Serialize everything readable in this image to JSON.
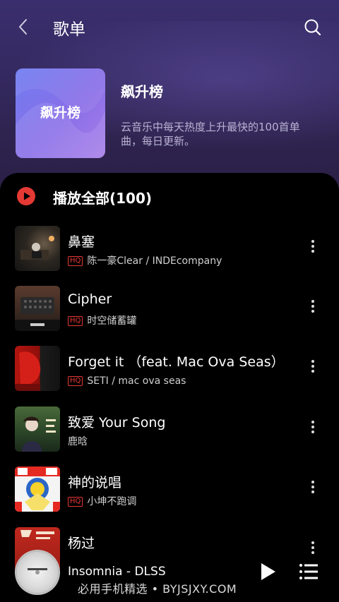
{
  "header": {
    "title": "歌单",
    "back_icon": "chevron-left-icon",
    "search_icon": "search-icon"
  },
  "playlist": {
    "cover_text": "飙升榜",
    "name": "飙升榜",
    "description": "云音乐中每天热度上升最快的100首单曲，每日更新。",
    "accent_color": "#e53935"
  },
  "play_all": {
    "label": "播放全部(100)",
    "icon": "play-circle-icon"
  },
  "songs": [
    {
      "title": "鼻塞",
      "hq": "HQ",
      "artist": "陈一豪Clear / INDEcompany"
    },
    {
      "title": "Cipher",
      "hq": "HQ",
      "artist": "时空储蓄罐"
    },
    {
      "title": "Forget it （feat. Mac Ova Seas）",
      "hq": "HQ",
      "artist": "SETI / mac ova seas"
    },
    {
      "title": "致爱 Your Song",
      "hq": "",
      "artist": "鹿晗"
    },
    {
      "title": "神的说唱",
      "hq": "HQ",
      "artist": "小坤不跑调"
    },
    {
      "title": "杨过",
      "hq": "",
      "artist": ""
    }
  ],
  "player": {
    "now_playing": "Insomnia - DLSS",
    "play_icon": "play-icon",
    "playlist_icon": "playlist-icon"
  },
  "watermark": "必用手机精选 • BYJSJXY.COM"
}
